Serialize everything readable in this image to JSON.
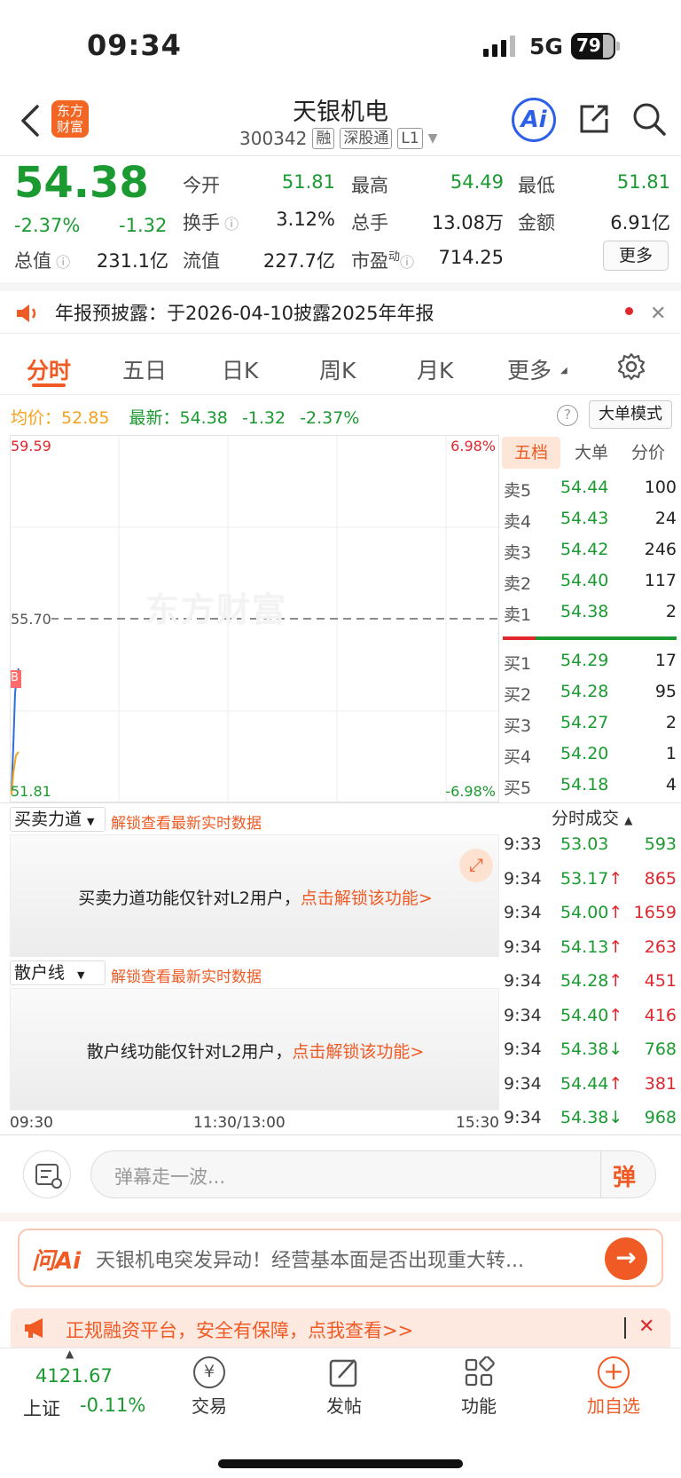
{
  "status": {
    "time": "09:34",
    "network": "5G",
    "battery": "79"
  },
  "header": {
    "logo_line1": "东方",
    "logo_line2": "财富",
    "stock_name": "天银机电",
    "code": "300342",
    "tags": [
      "融",
      "深股通",
      "L1"
    ],
    "ai_label": "Ai"
  },
  "quote": {
    "price": "54.38",
    "change_pct": "-2.37%",
    "change_amt": "-1.32",
    "open_label": "今开",
    "open": "51.81",
    "high_label": "最高",
    "high": "54.49",
    "low_label": "最低",
    "low": "51.81",
    "turnover_label": "换手",
    "turnover": "3.12%",
    "volume_label": "总手",
    "volume": "13.08万",
    "amount_label": "金额",
    "amount": "6.91亿",
    "total_value_label": "总值",
    "total_value": "231.1亿",
    "float_label": "流值",
    "float_value": "227.7亿",
    "pe_label": "市盈",
    "pe_sup": "动",
    "pe": "714.25",
    "more_label": "更多"
  },
  "notice": {
    "text": "年报预披露：于2026-04-10披露2025年年报"
  },
  "tabs": [
    "分时",
    "五日",
    "日K",
    "周K",
    "月K",
    "更多"
  ],
  "intraday": {
    "avg_label": "均价：",
    "avg_value": "52.85",
    "latest_label": "最新：",
    "latest_value": "54.38",
    "latest_change": "-1.32",
    "latest_pct": "-2.37%",
    "big_order_mode": "大单模式"
  },
  "chart": {
    "watermark": "东方财富",
    "y_max": "59.59",
    "pct_max": "6.98%",
    "prev_close": "55.70",
    "y_min": "51.81",
    "pct_min": "-6.98%",
    "marker": "B",
    "time_labels": [
      "09:30",
      "11:30/13:00",
      "15:30"
    ]
  },
  "orderbook": {
    "tabs": [
      "五档",
      "大单",
      "分价"
    ],
    "asks": [
      {
        "label": "卖5",
        "price": "54.44",
        "volume": "100"
      },
      {
        "label": "卖4",
        "price": "54.43",
        "volume": "24"
      },
      {
        "label": "卖3",
        "price": "54.42",
        "volume": "246"
      },
      {
        "label": "卖2",
        "price": "54.40",
        "volume": "117"
      },
      {
        "label": "卖1",
        "price": "54.38",
        "volume": "2"
      }
    ],
    "bids": [
      {
        "label": "买1",
        "price": "54.29",
        "volume": "17"
      },
      {
        "label": "买2",
        "price": "54.28",
        "volume": "95"
      },
      {
        "label": "买3",
        "price": "54.27",
        "volume": "2"
      },
      {
        "label": "买4",
        "price": "54.20",
        "volume": "1"
      },
      {
        "label": "买5",
        "price": "54.18",
        "volume": "4"
      }
    ]
  },
  "trades": {
    "title": "分时成交",
    "rows": [
      {
        "time": "9:33",
        "price": "53.03",
        "dir": "",
        "volume": "593",
        "color": "#1a9a30"
      },
      {
        "time": "9:34",
        "price": "53.17",
        "dir": "↑",
        "volume": "865",
        "color": "#e0272d"
      },
      {
        "time": "9:34",
        "price": "54.00",
        "dir": "↑",
        "volume": "1659",
        "color": "#e0272d"
      },
      {
        "time": "9:34",
        "price": "54.13",
        "dir": "↑",
        "volume": "263",
        "color": "#e0272d"
      },
      {
        "time": "9:34",
        "price": "54.28",
        "dir": "↑",
        "volume": "451",
        "color": "#e0272d"
      },
      {
        "time": "9:34",
        "price": "54.40",
        "dir": "↑",
        "volume": "416",
        "color": "#e0272d"
      },
      {
        "time": "9:34",
        "price": "54.38",
        "dir": "↓",
        "volume": "768",
        "color": "#1a9a30"
      },
      {
        "time": "9:34",
        "price": "54.44",
        "dir": "↑",
        "volume": "381",
        "color": "#e0272d"
      },
      {
        "time": "9:34",
        "price": "54.38",
        "dir": "↓",
        "volume": "968",
        "color": "#1a9a30"
      }
    ]
  },
  "panels": {
    "force": {
      "selector": "买卖力道",
      "hint": "解锁查看最新实时数据",
      "message": "买卖力道功能仅针对L2用户，",
      "link": "点击解锁该功能>"
    },
    "retail": {
      "selector": "散户线",
      "hint": "解锁查看最新实时数据",
      "message": "散户线功能仅针对L2用户，",
      "link": "点击解锁该功能>"
    }
  },
  "danmaku": {
    "placeholder": "弹幕走一波...",
    "send_label": "弹"
  },
  "ask_ai": {
    "logo": "问Ai",
    "text": "天银机电突发异动！经营基本面是否出现重大转..."
  },
  "ad": {
    "text": "正规融资平台，安全有保障，点我查看>>"
  },
  "nav": {
    "index_value": "4121.67",
    "index_name": "上证",
    "index_change": "-0.11%",
    "items": [
      "交易",
      "发帖",
      "功能",
      "加自选"
    ]
  }
}
